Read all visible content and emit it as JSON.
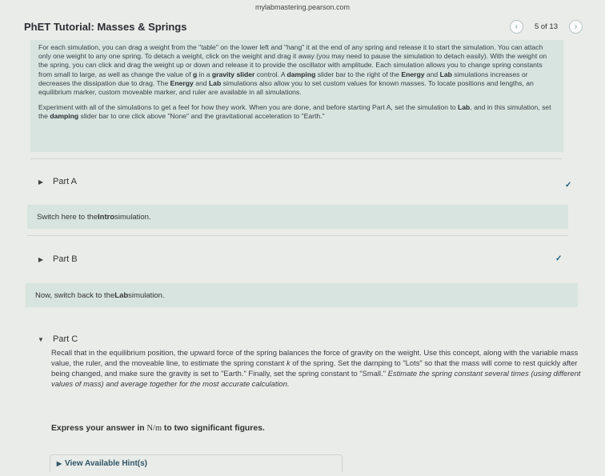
{
  "browser": {
    "url": "mylabmastering.pearson.com"
  },
  "header": {
    "title": "PhET Tutorial: Masses & Springs",
    "pager": {
      "prev_icon": "chevron-left-icon",
      "count": "5 of 13",
      "next_icon": "chevron-right-icon"
    }
  },
  "intro": {
    "p1": [
      {
        "t": "For each simulation, you can drag a weight from the \"table\" on the lower left and \"hang\" it at the end of any spring and release it to start the simulation. You can attach only one weight to any one spring. To detach a weight, click on the weight and drag it away (you may need to pause the simulation to detach easily). With the weight on the spring, you can click and drag the weight up or down and release it to provide the oscillator with amplitude. Each simulation allows you to change spring constants from small to large, as well as change the value of ",
        "b": false
      },
      {
        "t": "g",
        "b": true
      },
      {
        "t": " in a ",
        "b": false
      },
      {
        "t": "gravity slider",
        "b": true
      },
      {
        "t": " control. A ",
        "b": false
      },
      {
        "t": "damping",
        "b": true
      },
      {
        "t": " slider bar to the right of the ",
        "b": false
      },
      {
        "t": "Energy",
        "b": true
      },
      {
        "t": " and ",
        "b": false
      },
      {
        "t": "Lab",
        "b": true
      },
      {
        "t": " simulations increases or decreases the dissipation due to drag. The ",
        "b": false
      },
      {
        "t": "Energy",
        "b": true
      },
      {
        "t": " and ",
        "b": false
      },
      {
        "t": "Lab",
        "b": true
      },
      {
        "t": " simulations also allow you to set custom values for known masses. To locate positions and lengths, an equilibrium marker, custom moveable marker, and ruler are available in all simulations.",
        "b": false
      }
    ],
    "p2": [
      {
        "t": "Experiment with all of the simulations to get a feel for how they work. When you are done, and before starting Part A, set the simulation to ",
        "b": false
      },
      {
        "t": "Lab",
        "b": true
      },
      {
        "t": ", and in this simulation, set the ",
        "b": false
      },
      {
        "t": "damping",
        "b": true
      },
      {
        "t": " slider bar to one click above \"None\" and the gravitational acceleration to \"Earth.\"",
        "b": false
      }
    ]
  },
  "parts": {
    "a": {
      "label": "Part A",
      "note_pre": "Switch here to the ",
      "note_bold": "Intro",
      "note_post": " simulation."
    },
    "b": {
      "label": "Part B",
      "note_pre": "Now, switch back to the ",
      "note_bold": "Lab",
      "note_post": " simulation."
    },
    "c": {
      "label": "Part C"
    }
  },
  "partc": {
    "body": [
      {
        "t": "Recall that in the equilibrium position, the upward force of the spring balances the force of gravity on the weight. Use this concept, along with the variable mass value, the ruler, and the moveable line, to estimate the spring constant ",
        "s": "n"
      },
      {
        "t": "k",
        "s": "i"
      },
      {
        "t": " of the spring. Set the damping to \"Lots\" so that the mass will come to rest quickly after being changed, and make sure the gravity is set to \"Earth.\" Finally, set the spring constant to \"Small.\" ",
        "s": "n"
      },
      {
        "t": "Estimate the spring constant several times (using different values of mass) and average together for the most accurate calculation.",
        "s": "i"
      }
    ],
    "express_pre": "Express your answer in ",
    "express_unit": "N/m",
    "express_post": " to two significant figures.",
    "hints_label": "View Available Hint(s)"
  }
}
